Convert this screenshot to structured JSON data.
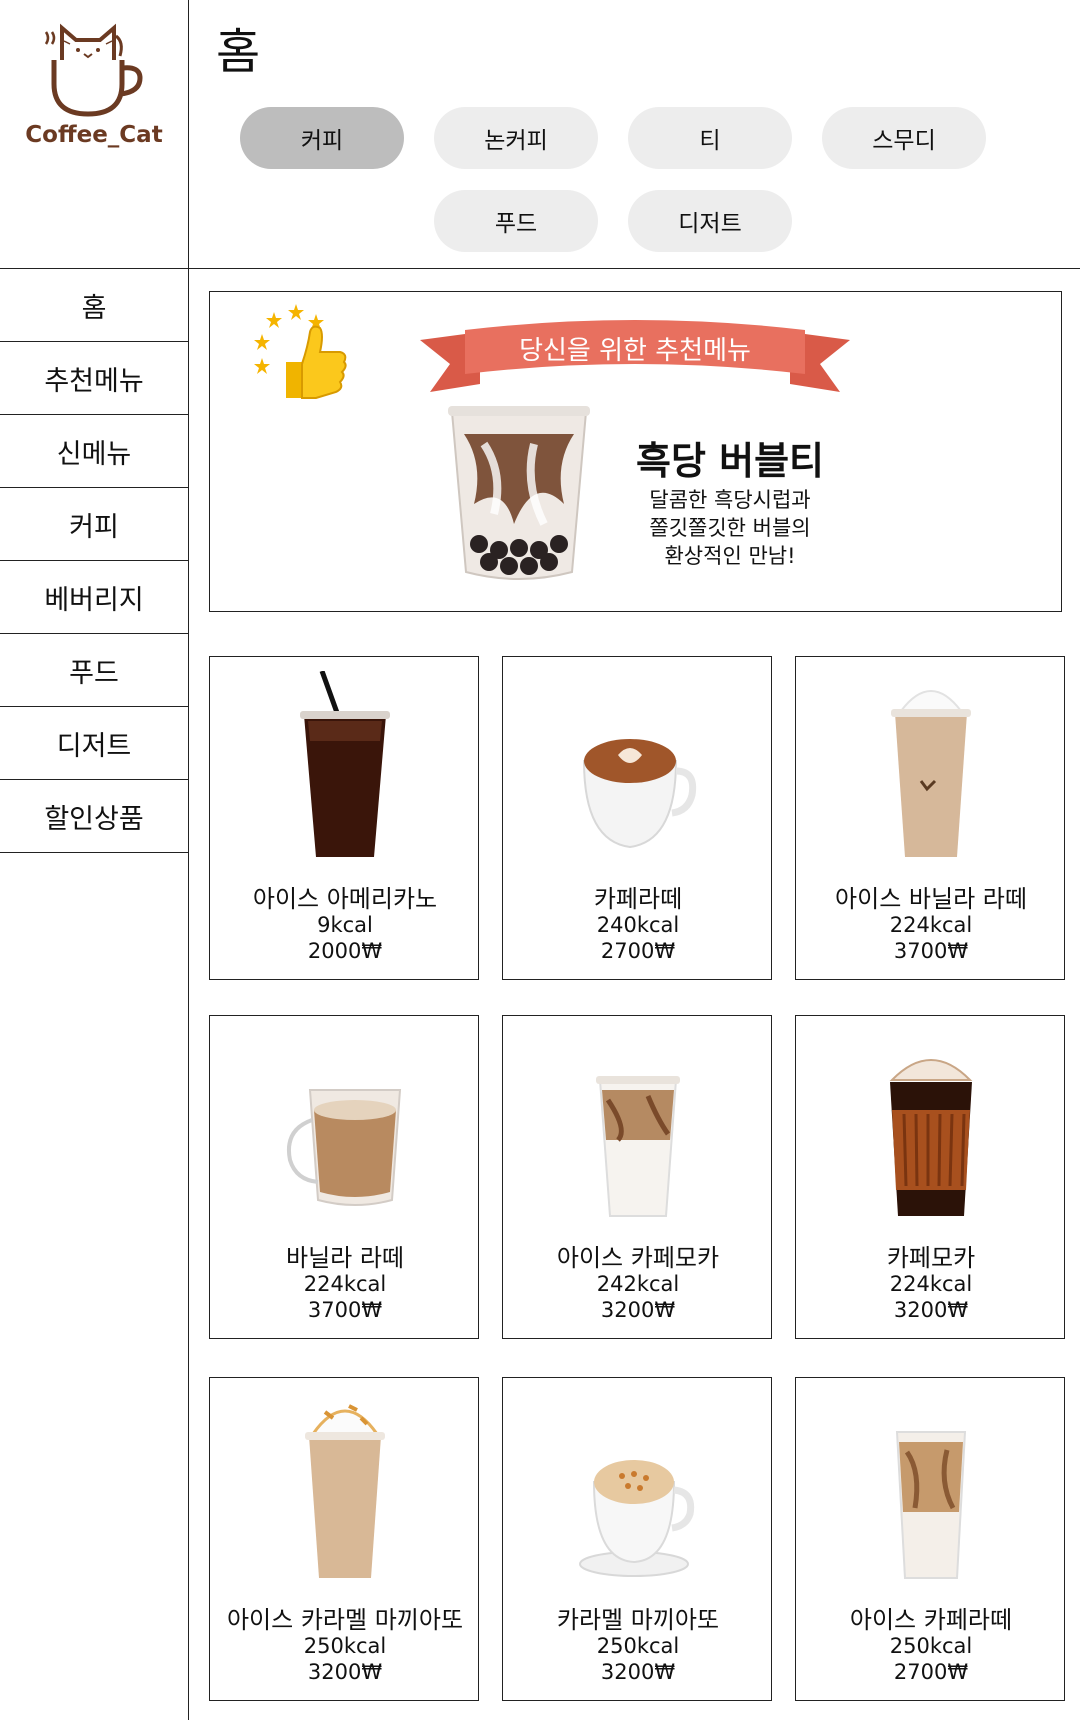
{
  "brand": {
    "name": "Coffee_Cat"
  },
  "page": {
    "title": "홈"
  },
  "tabs": [
    {
      "label": "커피",
      "active": true
    },
    {
      "label": "논커피",
      "active": false
    },
    {
      "label": "티",
      "active": false
    },
    {
      "label": "스무디",
      "active": false
    },
    {
      "label": "푸드",
      "active": false
    },
    {
      "label": "디저트",
      "active": false
    }
  ],
  "sidebar": {
    "items": [
      {
        "label": "홈"
      },
      {
        "label": "추천메뉴"
      },
      {
        "label": "신메뉴"
      },
      {
        "label": "커피"
      },
      {
        "label": "베버리지"
      },
      {
        "label": "푸드"
      },
      {
        "label": "디저트"
      },
      {
        "label": "할인상품"
      }
    ]
  },
  "banner": {
    "ribbon": "당신을 위한 추천메뉴",
    "product_name": "흑당 버블티",
    "description": [
      "달콤한 흑당시럽과",
      "쫄깃쫄깃한 버블의",
      "환상적인 만남!"
    ],
    "icon": "thumbs-up-stars-icon"
  },
  "products": [
    {
      "name": "아이스 아메리카노",
      "kcal": "9kcal",
      "price": "2000₩",
      "image": "iced-americano-image"
    },
    {
      "name": "카페라떼",
      "kcal": "240kcal",
      "price": "2700₩",
      "image": "cafe-latte-image"
    },
    {
      "name": "아이스 바닐라 라떼",
      "kcal": "224kcal",
      "price": "3700₩",
      "image": "iced-vanilla-latte-image"
    },
    {
      "name": "바닐라 라떼",
      "kcal": "224kcal",
      "price": "3700₩",
      "image": "vanilla-latte-image"
    },
    {
      "name": "아이스 카페모카",
      "kcal": "242kcal",
      "price": "3200₩",
      "image": "iced-cafe-mocha-image"
    },
    {
      "name": "카페모카",
      "kcal": "224kcal",
      "price": "3200₩",
      "image": "cafe-mocha-image"
    },
    {
      "name": "아이스 카라멜 마끼아또",
      "kcal": "250kcal",
      "price": "3200₩",
      "image": "iced-caramel-macchiato-image"
    },
    {
      "name": "카라멜 마끼아또",
      "kcal": "250kcal",
      "price": "3200₩",
      "image": "caramel-macchiato-image"
    },
    {
      "name": "아이스 카페라떼",
      "kcal": "250kcal",
      "price": "2700₩",
      "image": "iced-cafe-latte-image"
    }
  ],
  "colors": {
    "brand": "#6b3a22",
    "ribbon": "#e8705f",
    "tab_active": "#bdbdbd",
    "tab": "#ededed"
  }
}
